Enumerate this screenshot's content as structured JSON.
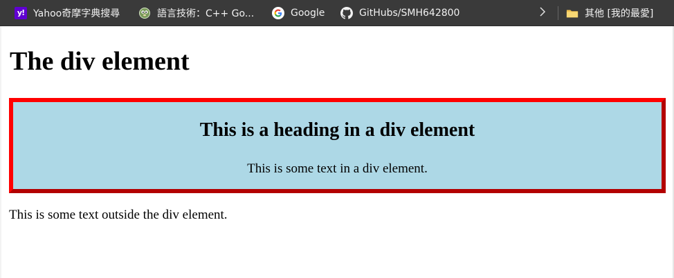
{
  "bookmarks": {
    "items": [
      {
        "label": "Yahoo奇摩字典搜尋",
        "icon": "yahoo-icon"
      },
      {
        "label": "語言技術：C++ Go...",
        "icon": "gopher-icon"
      },
      {
        "label": "Google",
        "icon": "google-icon"
      },
      {
        "label": "GitHubs/SMH642800",
        "icon": "github-icon"
      }
    ],
    "more_icon": "chevron-right-icon",
    "other_folder": {
      "label": "其他 [我的最愛]",
      "icon": "folder-icon"
    }
  },
  "page": {
    "title": "The div element",
    "div_heading": "This is a heading in a div element",
    "div_text": "This is some text in a div element.",
    "outside_text": "This is some text outside the div element."
  },
  "colors": {
    "bookmarks_bar_bg": "#3a3a3a",
    "div_background": "#add8e6",
    "div_border": "#ff0000",
    "yahoo_purple": "#6001d2",
    "folder_yellow": "#f2c14e"
  }
}
